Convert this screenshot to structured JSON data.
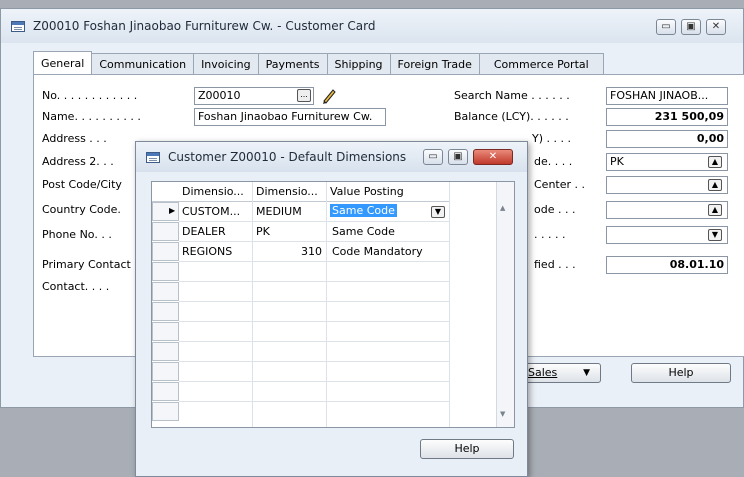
{
  "main_window": {
    "title": "Z00010 Foshan Jinaobao Furniturew Cw. - Customer Card",
    "controls": {
      "minimize": "▭",
      "maximize": "▣",
      "close": "✕"
    },
    "tabs": [
      "General",
      "Communication",
      "Invoicing",
      "Payments",
      "Shipping",
      "Foreign Trade",
      "Commerce Portal"
    ],
    "active_tab": "General",
    "left_fields": {
      "no_label": "No. . . . . . . . . . . .",
      "no_value": "Z00010",
      "name_label": "Name. . . . . . . . . .",
      "name_value": "Foshan Jinaobao Furniturew Cw.",
      "address_label": "Address . . .",
      "address2_label": "Address 2. . .",
      "postcode_label": "Post Code/City",
      "country_label": "Country Code.",
      "phone_label": "Phone No. . .",
      "primary_contact_label": "Primary Contact",
      "contact_label": "Contact. . . ."
    },
    "right_fields": {
      "search_name_label": "Search Name . . . . . .",
      "search_name_value": "FOSHAN JINAOB...",
      "balance_label": "Balance (LCY). . . . . .",
      "balance_value": "231 500,09",
      "row3_label": "Y) . . . .",
      "row3_value": "0,00",
      "row4_label": "de. . . .",
      "row4_value": "PK",
      "row5_label": "Center . .",
      "row6_label": "ode . . .",
      "row7_label": ". . . . .",
      "modified_label": "fied . . .",
      "modified_value": "08.01.10"
    },
    "buttons": {
      "sales": "Sales",
      "help": "Help"
    }
  },
  "dialog": {
    "title": "Customer Z00010 - Default Dimensions",
    "columns": [
      "Dimensio...",
      "Dimensio...",
      "Value Posting"
    ],
    "rows": [
      {
        "dimension": "CUSTOM...",
        "value": "MEDIUM",
        "posting": "Same Code"
      },
      {
        "dimension": "DEALER",
        "value": "PK",
        "posting": "Same Code"
      },
      {
        "dimension": "REGIONS",
        "value": "310",
        "posting": "Code Mandatory"
      }
    ],
    "help_button": "Help"
  },
  "icons": {
    "window_icon": "form-icon",
    "assist_button": "...",
    "edit_icon": "pencil-icon",
    "row_pointer": "▶",
    "up_arrow": "▲",
    "down_arrow": "▼"
  }
}
